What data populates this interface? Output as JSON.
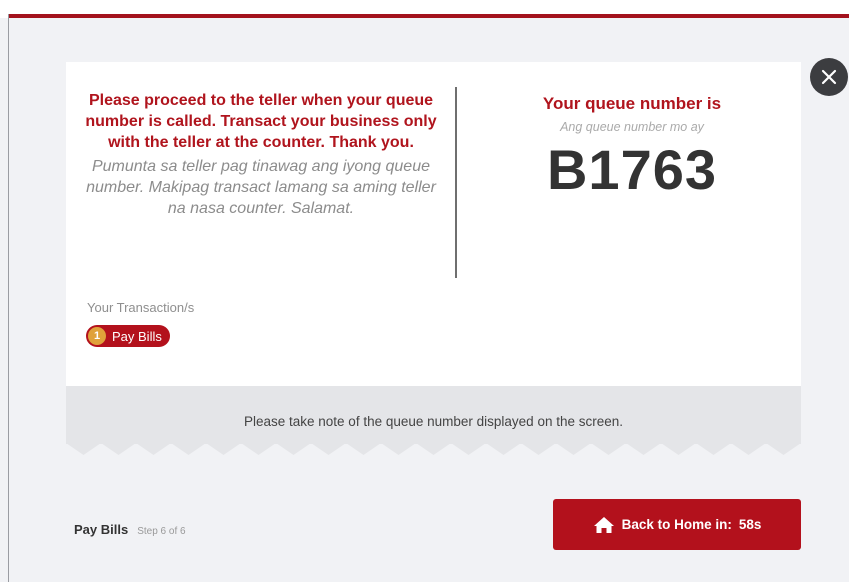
{
  "instructions": {
    "english": "Please proceed to the teller when your queue number is called. Transact your business only with the teller at the counter. Thank you.",
    "filipino": "Pumunta sa teller pag tinawag ang iyong queue number. Makipag transact lamang sa aming teller na nasa counter. Salamat."
  },
  "queue": {
    "title": "Your queue number is",
    "subtitle": "Ang queue number mo ay",
    "number": "B1763"
  },
  "transactions": {
    "label": "Your Transaction/s",
    "items": [
      {
        "count": "1",
        "label": "Pay Bills"
      }
    ]
  },
  "note": "Please take note of the queue number displayed on the screen.",
  "footer": {
    "step_title": "Pay Bills",
    "step_count": "Step 6 of 6",
    "home_button_label": "Back to Home in:",
    "countdown": "58s"
  },
  "colors": {
    "brand_red": "#b3111c",
    "badge_gold": "#e0a13a",
    "close_dark": "#3c3d40"
  },
  "icons": {
    "close": "close-icon",
    "home": "home-icon"
  }
}
